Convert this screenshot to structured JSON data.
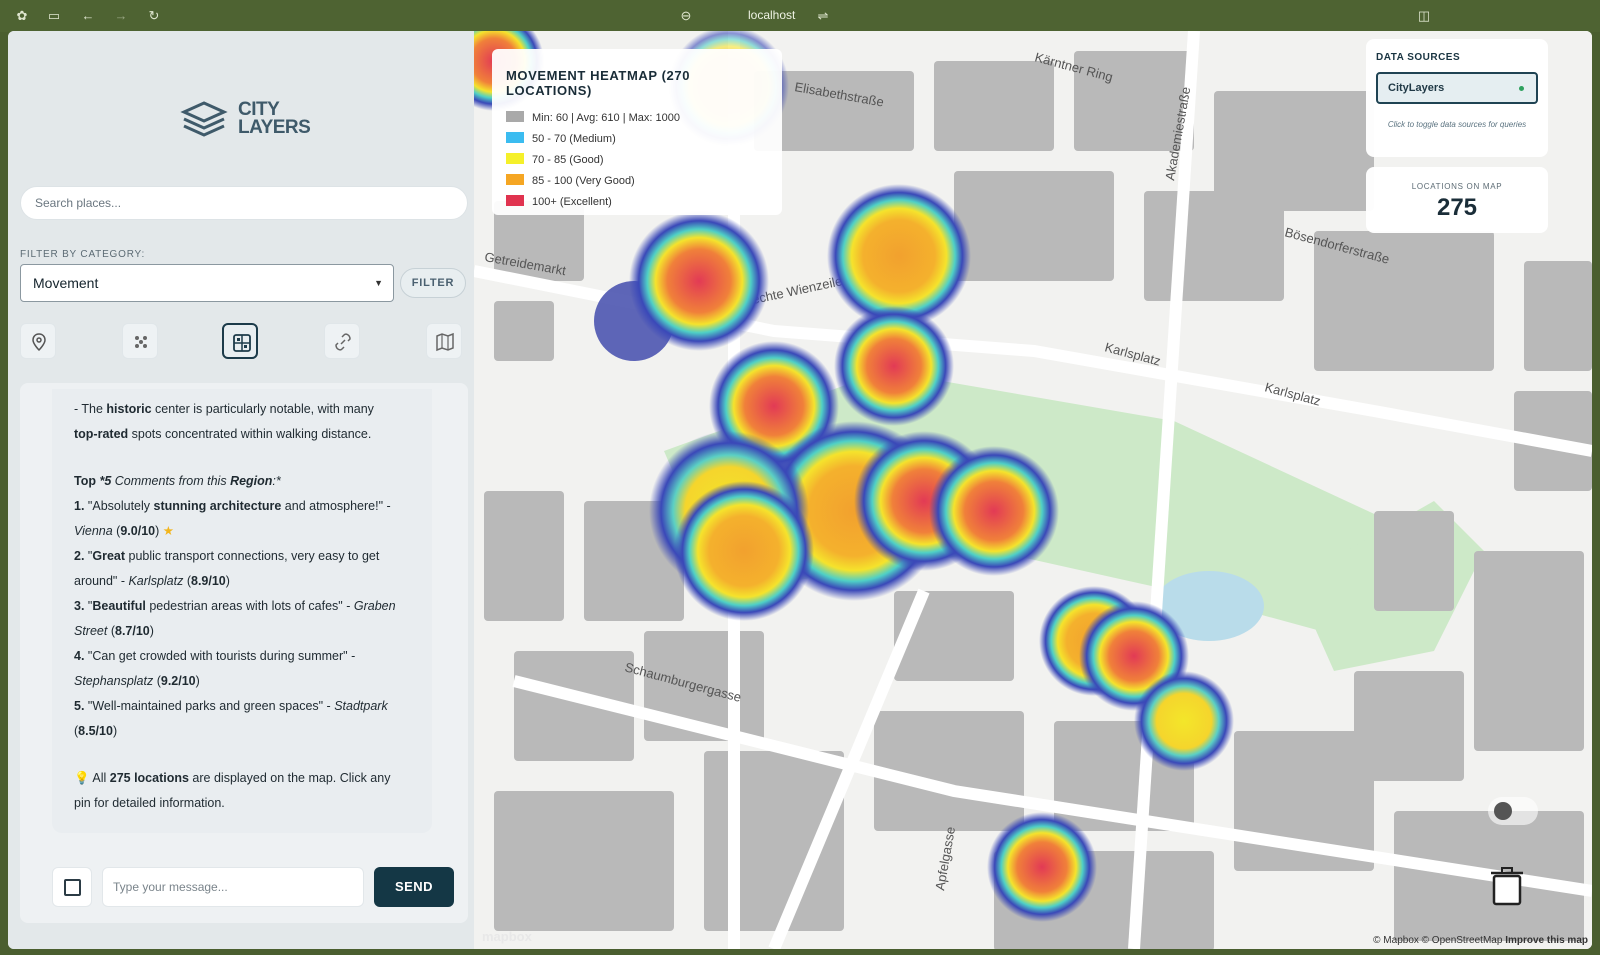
{
  "browser": {
    "url": "localhost"
  },
  "sidebar": {
    "logo_line1": "CITY",
    "logo_line2": "LAYERS",
    "search_placeholder": "Search places...",
    "filter_label": "FILTER BY CATEGORY:",
    "selected_category": "Movement",
    "filter_button": "FILTER",
    "tools": [
      "pin-icon",
      "cluster-icon",
      "grid-icon",
      "link-icon",
      "map-icon"
    ],
    "active_tool": "grid-icon"
  },
  "chat": {
    "line1_pre": "- The ",
    "line1_b1": "historic",
    "line1_mid": " center is particularly notable, with many",
    "line2_b": "top-rated",
    "line2_rest": " spots concentrated within walking distance.",
    "top_heading_pre": "Top ",
    "top_heading_num": "*5",
    "top_heading_mid": " Comments from this ",
    "top_heading_region": "Region",
    "top_heading_end": ":*",
    "comments": [
      {
        "num": "1.",
        "pre": "\"Absolutely ",
        "bold": "stunning architecture",
        "post": " and atmosphere!\" -",
        "place": "Vienna",
        "rating": "9.0/10",
        "star": true
      },
      {
        "num": "2.",
        "pre": "\"",
        "bold": "Great",
        "post": " public transport connections, very easy to get around\" - ",
        "place": "Karlsplatz",
        "rating": "8.9/10"
      },
      {
        "num": "3.",
        "pre": "\"",
        "bold": "Beautiful",
        "post": " pedestrian areas with lots of cafes\" - ",
        "place": "Graben Street",
        "rating": "8.7/10"
      },
      {
        "num": "4.",
        "pre": "\"Can get crowded with tourists during summer\" - ",
        "bold": "",
        "post": "",
        "place": "Stephansplatz",
        "rating": "9.2/10"
      },
      {
        "num": "5.",
        "pre": "\"Well-maintained parks and green spaces\" - ",
        "bold": "",
        "post": "",
        "place": "Stadtpark",
        "rating": "8.5/10"
      }
    ],
    "footer_pre": "All ",
    "footer_bold": "275 locations",
    "footer_rest": " are displayed on the map. Click any pin for detailed information.",
    "input_placeholder": "Type your message...",
    "send_label": "SEND"
  },
  "map": {
    "legend_title": "MOVEMENT HEATMAP (270 LOCATIONS)",
    "legend_rows": [
      {
        "label": "Min: 60 | Avg: 610 | Max: 1000",
        "color": "#a9a9a9"
      },
      {
        "label": "50 - 70 (Medium)",
        "color": "#3bbcf0"
      },
      {
        "label": "70 - 85 (Good)",
        "color": "#f5f02a"
      },
      {
        "label": "85 - 100 (Very Good)",
        "color": "#f5a623"
      },
      {
        "label": "100+ (Excellent)",
        "color": "#e0334f"
      }
    ],
    "data_sources_title": "DATA SOURCES",
    "data_source_item": "CityLayers",
    "data_sources_hint": "Click to toggle data sources for queries",
    "locations_label": "LOCATIONS ON MAP",
    "locations_value": "275",
    "attribution_1": "© Mapbox © OpenStreetMap ",
    "attribution_2": "Improve this map",
    "mapbox_logo": "mapbox",
    "street_labels": [
      "Getreidemarkt",
      "Rechte Wienzeile",
      "Karlsplatz",
      "Karlsplatz",
      "Bösendorferstraße",
      "Akademiestraße",
      "Schaumburgergasse",
      "Apfelgasse",
      "Elisabethstraße",
      "Kärntner Ring"
    ]
  }
}
